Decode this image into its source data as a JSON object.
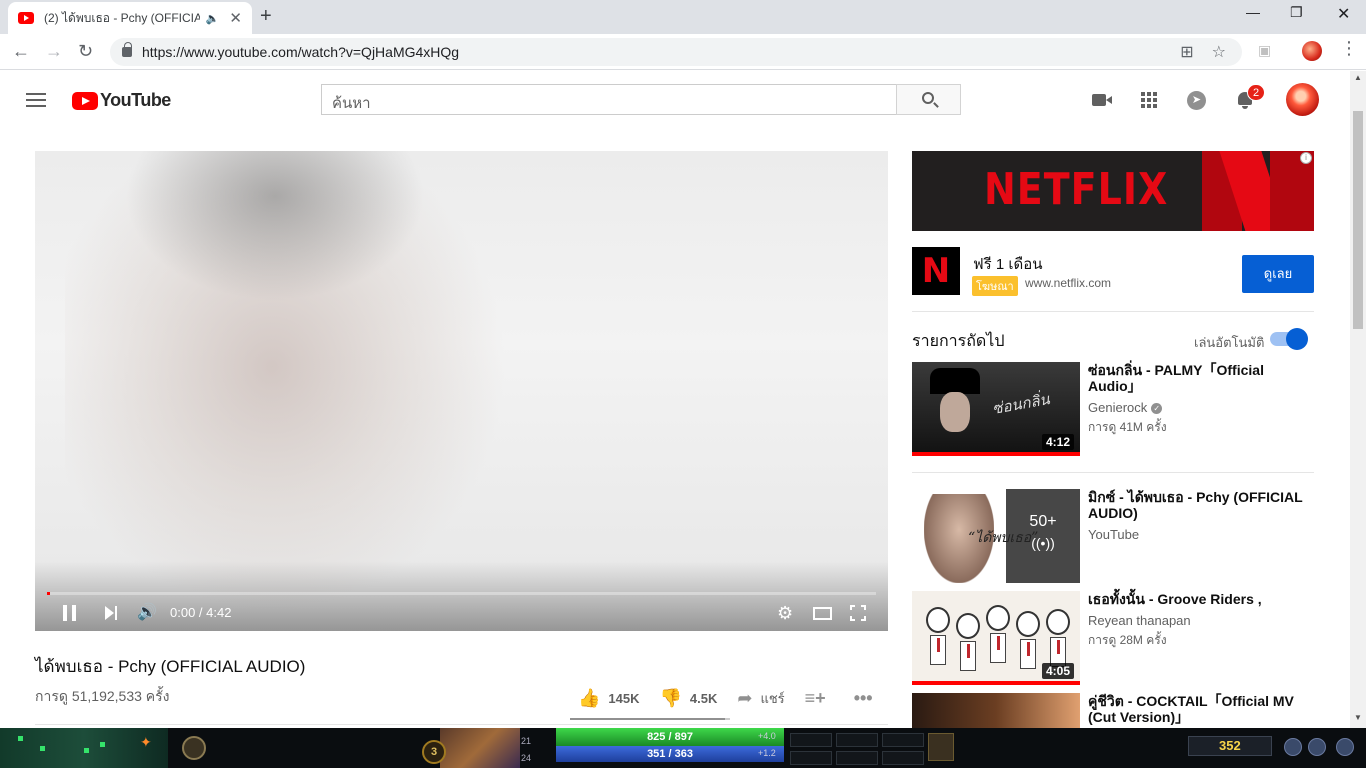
{
  "browser": {
    "tab_title": "(2) ได้พบเธอ - Pchy (OFFICIAL",
    "url": "https://www.youtube.com/watch?v=QjHaMG4xHQg"
  },
  "masthead": {
    "logo_text": "YouTube",
    "search_placeholder": "ค้นหา",
    "notification_count": "2"
  },
  "player": {
    "time": "0:00 / 4:42",
    "progress_fraction": 0.004
  },
  "video": {
    "title": "ได้พบเธอ - Pchy (OFFICIAL AUDIO)",
    "views": "การดู 51,192,533 ครั้ง",
    "likes": "145K",
    "dislikes": "4.5K",
    "share_label": "แชร์",
    "like_fraction": 0.97
  },
  "ad": {
    "banner_text": "NETFLIX",
    "logo_letter": "N",
    "title": "ฟรี 1 เดือน",
    "tag": "โฆษณา",
    "url": "www.netflix.com",
    "cta": "ดูเลย"
  },
  "sidebar": {
    "up_next_label": "รายการถัดไป",
    "autoplay_label": "เล่นอัตโนมัติ",
    "autoplay_on": true,
    "items": [
      {
        "title": "ซ่อนกลิ่น - PALMY「Official Audio」",
        "channel": "Genierock",
        "views": "การดู 41M ครั้ง",
        "duration": "4:12",
        "thumb_text": "ซ่อนกลิ่น"
      },
      {
        "title": "มิกซ์ - ได้พบเธอ - Pchy (OFFICIAL AUDIO)",
        "channel": "YouTube",
        "overlay_count": "50+",
        "thumb_text": "“ได้พบเธอ”"
      },
      {
        "title": "เธอทั้งนั้น - Groove Riders ,",
        "channel": "Reyean thanapan",
        "views": "การดู 28M ครั้ง",
        "duration": "4:05"
      },
      {
        "title": "คู่ชีวิต - COCKTAIL「Official MV (Cut Version)」"
      }
    ]
  },
  "taskbar": {
    "hero_level": "3",
    "stat_top": "21",
    "stat_bottom": "24",
    "hp": "825 / 897",
    "hp_regen": "+4.0",
    "mana": "351 / 363",
    "mana_regen": "+1.2",
    "gold": "352"
  }
}
